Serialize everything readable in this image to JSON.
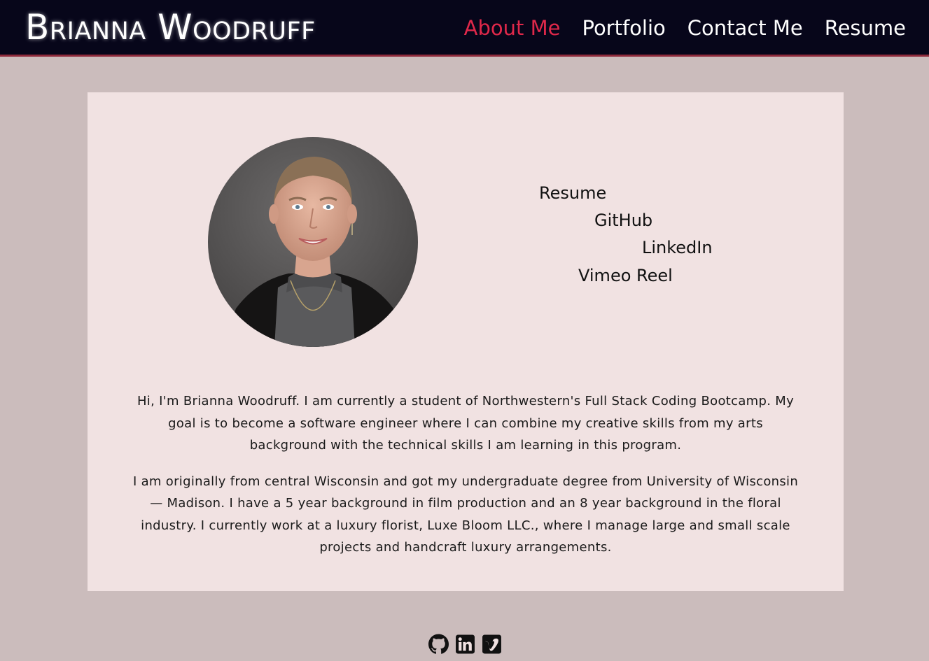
{
  "header": {
    "brand": "Brianna Woodruff",
    "nav": [
      {
        "label": "About Me",
        "active": true
      },
      {
        "label": "Portfolio",
        "active": false
      },
      {
        "label": "Contact Me",
        "active": false
      },
      {
        "label": "Resume",
        "active": false
      }
    ]
  },
  "profile": {
    "links": [
      "Resume",
      "GitHub",
      "LinkedIn",
      "Vimeo Reel"
    ]
  },
  "bio": {
    "paragraphs": [
      "Hi, I'm Brianna Woodruff. I am currently a student of Northwestern's Full Stack Coding Bootcamp. My goal is to become a software engineer where I can combine my creative skills from my arts background with the technical skills I am learning in this program.",
      "I am originally from central Wisconsin and got my undergraduate degree from University of Wisconsin — Madison. I have a 5 year background in film production and an 8 year background in the floral industry. I currently work at a luxury florist, Luxe Bloom LLC., where I manage large and small scale projects and handcraft luxury arrangements."
    ]
  },
  "footer": {
    "icons": [
      "github-icon",
      "linkedin-icon",
      "vimeo-icon"
    ]
  },
  "colors": {
    "header_bg": "#07061a",
    "accent": "#e0284a",
    "page_bg": "#cbbcbc",
    "card_bg": "#f1e2e2"
  }
}
